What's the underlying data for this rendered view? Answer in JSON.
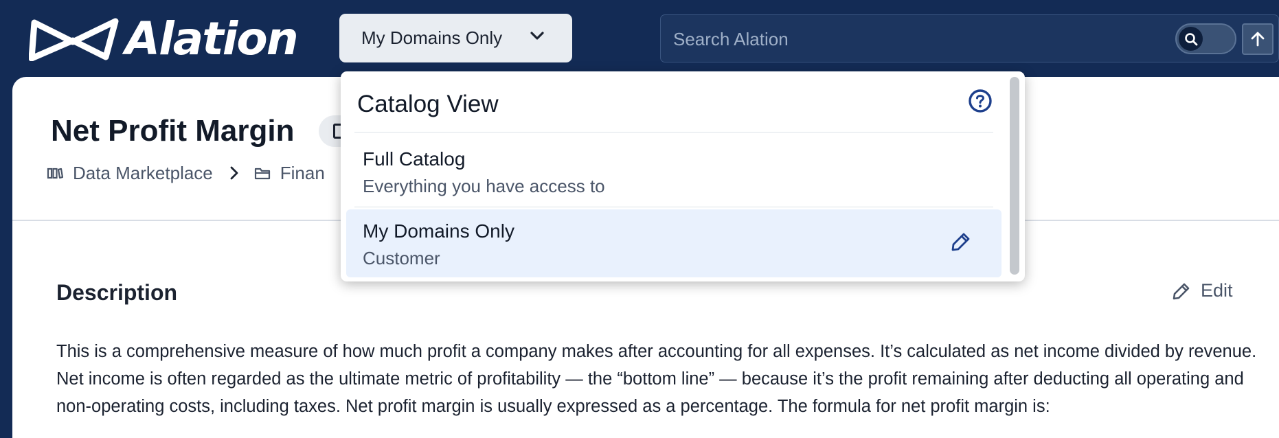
{
  "header": {
    "brand": "Alation",
    "domain_select": {
      "label": "My Domains Only"
    },
    "search": {
      "placeholder": "Search Alation"
    }
  },
  "page": {
    "title": "Net Profit Margin",
    "breadcrumb": [
      {
        "label": "Data Marketplace",
        "icon": "marketplace-icon"
      },
      {
        "label": "Finan",
        "icon": "folder-icon"
      }
    ],
    "description": {
      "heading": "Description",
      "edit_label": "Edit",
      "body": "This is a comprehensive measure of how much profit a company makes after accounting for all expenses. It’s calculated as net income divided by revenue. Net income is often regarded as the ultimate metric of profitability — the “bottom line” — because it’s the profit remaining after deducting all operating and non-operating costs, including taxes. Net profit margin is usually expressed as a percentage. The formula for net profit margin is:"
    }
  },
  "catalog_dropdown": {
    "title": "Catalog View",
    "options": [
      {
        "title": "Full Catalog",
        "subtitle": "Everything you have access to",
        "selected": false
      },
      {
        "title": "My Domains Only",
        "subtitle": "Customer",
        "selected": true
      }
    ]
  },
  "colors": {
    "header_bg": "#132b55",
    "selected_option_bg": "#e9f1fd",
    "accent": "#1d3f8c"
  }
}
